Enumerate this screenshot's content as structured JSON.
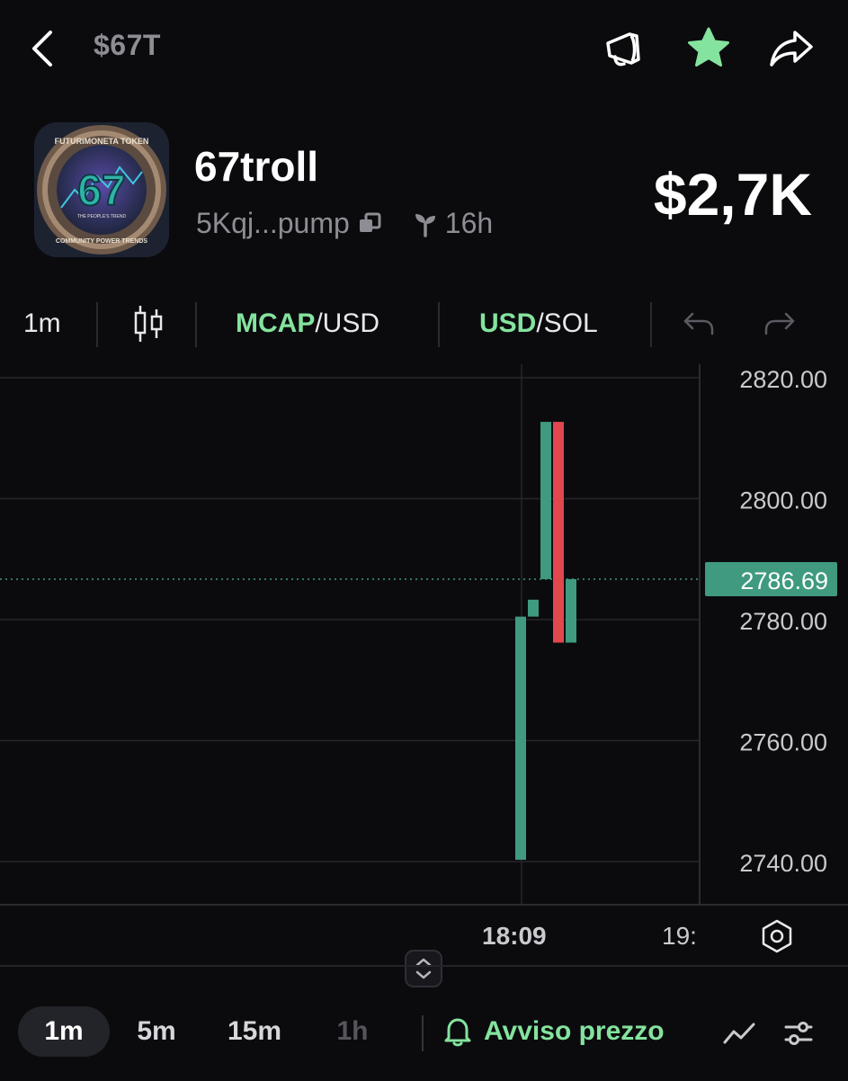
{
  "header": {
    "ticker": "$67T",
    "token_name": "67troll",
    "address": "5Kqj...pump",
    "age": "16h",
    "market_cap": "$2,7K",
    "icons": [
      "chevron-left-icon",
      "megaphone-icon",
      "star-icon",
      "share-icon",
      "copy-icon",
      "sprout-icon"
    ],
    "star_color": "#84e39e"
  },
  "avatar": {
    "big_number": "67",
    "ring_text_top": "FUTURIMONETA TOKEN",
    "ring_text_mid": "THE PEOPLE'S TREND",
    "ring_text_bottom": "COMMUNITY POWER TRENDS"
  },
  "toolbar": {
    "interval": "1m",
    "mcap_label": "MCAP",
    "mcap_suffix": "/USD",
    "usd_label": "USD",
    "usd_suffix": "/SOL",
    "icons": [
      "candlestick-icon",
      "undo-icon",
      "redo-icon"
    ],
    "accent_color": "#84e39e"
  },
  "chart_data": {
    "type": "candlestick",
    "y_ticks": [
      "2820.00",
      "2800.00",
      "2780.00",
      "2760.00",
      "2740.00"
    ],
    "current_price": "2786.69",
    "x_ticks": [
      "18:09",
      "19:"
    ],
    "candles": [
      {
        "open": 2740.3,
        "close": 2780.5,
        "high": 2780.5,
        "low": 2740.3,
        "direction": "up"
      },
      {
        "open": 2780.5,
        "close": 2783.3,
        "high": 2783.3,
        "low": 2780.5,
        "direction": "up"
      },
      {
        "open": 2786.7,
        "close": 2812.7,
        "high": 2812.7,
        "low": 2786.7,
        "direction": "up"
      },
      {
        "open": 2812.7,
        "close": 2776.2,
        "high": 2812.7,
        "low": 2776.2,
        "direction": "down"
      },
      {
        "open": 2776.2,
        "close": 2786.7,
        "high": 2786.7,
        "low": 2776.2,
        "direction": "up"
      }
    ],
    "ylim": [
      2732,
      2827
    ],
    "grid": true,
    "up_color": "#3f9a7f",
    "down_color": "#e0474f"
  },
  "bottom": {
    "timeframes": [
      "1m",
      "5m",
      "15m",
      "1h"
    ],
    "active_timeframe": "1m",
    "alert_label": "Avviso prezzo",
    "icons": [
      "bell-icon",
      "line-chart-icon",
      "sliders-icon",
      "expand-vertical-icon",
      "settings-hex-icon"
    ]
  }
}
